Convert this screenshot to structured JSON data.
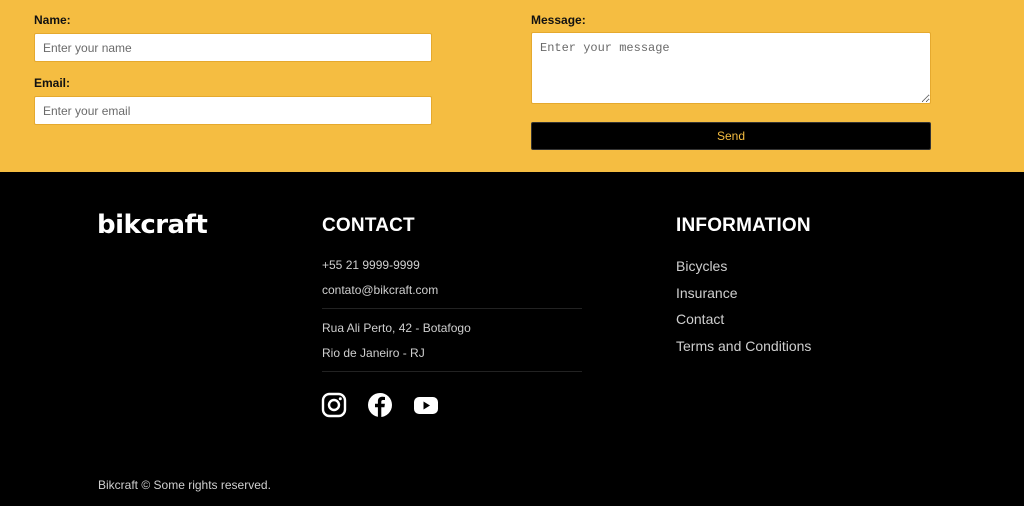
{
  "form": {
    "name_label": "Name:",
    "name_placeholder": "Enter your name",
    "email_label": "Email:",
    "email_placeholder": "Enter your email",
    "message_label": "Message:",
    "message_placeholder": "Enter your message",
    "send_label": "Send"
  },
  "footer": {
    "logo": "bikcraft",
    "contact": {
      "title": "CONTACT",
      "phone": "+55 21 9999-9999",
      "email": "contato@bikcraft.com",
      "address_line1": "Rua Ali Perto, 42 - Botafogo",
      "address_line2": "Rio de Janeiro - RJ",
      "social": [
        "instagram-icon",
        "facebook-icon",
        "youtube-icon"
      ]
    },
    "information": {
      "title": "INFORMATION",
      "links": [
        "Bicycles",
        "Insurance",
        "Contact",
        "Terms and Conditions"
      ]
    },
    "copyright": "Bikcraft © Some rights reserved."
  },
  "colors": {
    "accent": "#f5bd41",
    "footer_bg": "#000000",
    "footer_text": "#cfcfcf"
  }
}
